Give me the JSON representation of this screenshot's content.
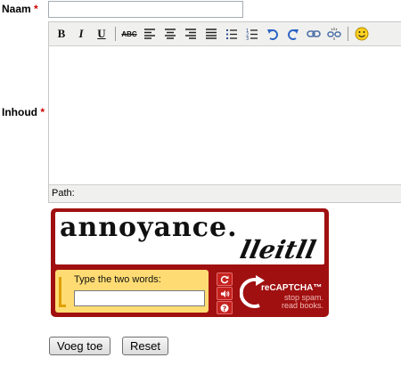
{
  "form": {
    "name_label": "Naam",
    "content_label": "Inhoud",
    "required_marker": "*",
    "name_value": ""
  },
  "editor": {
    "toolbar_icons": [
      "bold-icon",
      "italic-icon",
      "underline-icon",
      "strikethrough-icon",
      "align-left-icon",
      "align-center-icon",
      "align-right-icon",
      "align-justify-icon",
      "bullet-list-icon",
      "numbered-list-icon",
      "undo-icon",
      "redo-icon",
      "link-icon",
      "unlink-icon",
      "emoticon-icon"
    ],
    "bold_glyph": "B",
    "italic_glyph": "I",
    "underline_glyph": "U",
    "strike_glyph": "ABC",
    "path_label": "Path:"
  },
  "captcha": {
    "word1": "annoyance.",
    "word2": "lleitll",
    "prompt": "Type the two words:",
    "answer": "",
    "brand": "reCAPTCHA™",
    "tagline1": "stop spam.",
    "tagline2": "read books.",
    "colors": {
      "frame": "#a01010",
      "answer_bg": "#ffdc73"
    }
  },
  "buttons": {
    "submit": "Voeg toe",
    "reset": "Reset"
  }
}
